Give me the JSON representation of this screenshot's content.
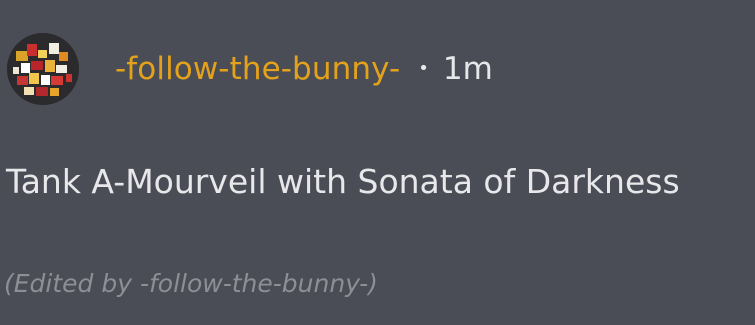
{
  "comment": {
    "author": "-follow-the-bunny-",
    "separator": "•",
    "timestamp": "1m",
    "body": "Tank A-Mourveil with Sonata of Darkness",
    "edited_note": "(Edited by -follow-the-bunny-)"
  },
  "colors": {
    "background": "#4a4d56",
    "author": "#e3a21a",
    "text": "#e8e8ea",
    "muted": "#8d8f96"
  }
}
